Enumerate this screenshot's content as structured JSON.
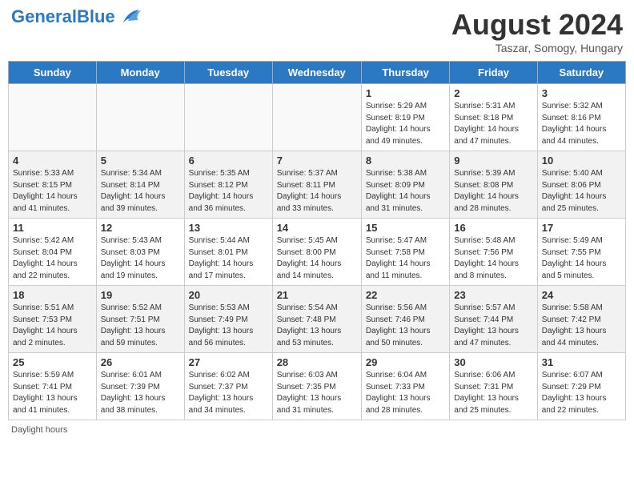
{
  "header": {
    "logo_general": "General",
    "logo_blue": "Blue",
    "month": "August 2024",
    "location": "Taszar, Somogy, Hungary"
  },
  "days_of_week": [
    "Sunday",
    "Monday",
    "Tuesday",
    "Wednesday",
    "Thursday",
    "Friday",
    "Saturday"
  ],
  "weeks": [
    [
      {
        "num": "",
        "info": ""
      },
      {
        "num": "",
        "info": ""
      },
      {
        "num": "",
        "info": ""
      },
      {
        "num": "",
        "info": ""
      },
      {
        "num": "1",
        "info": "Sunrise: 5:29 AM\nSunset: 8:19 PM\nDaylight: 14 hours\nand 49 minutes."
      },
      {
        "num": "2",
        "info": "Sunrise: 5:31 AM\nSunset: 8:18 PM\nDaylight: 14 hours\nand 47 minutes."
      },
      {
        "num": "3",
        "info": "Sunrise: 5:32 AM\nSunset: 8:16 PM\nDaylight: 14 hours\nand 44 minutes."
      }
    ],
    [
      {
        "num": "4",
        "info": "Sunrise: 5:33 AM\nSunset: 8:15 PM\nDaylight: 14 hours\nand 41 minutes."
      },
      {
        "num": "5",
        "info": "Sunrise: 5:34 AM\nSunset: 8:14 PM\nDaylight: 14 hours\nand 39 minutes."
      },
      {
        "num": "6",
        "info": "Sunrise: 5:35 AM\nSunset: 8:12 PM\nDaylight: 14 hours\nand 36 minutes."
      },
      {
        "num": "7",
        "info": "Sunrise: 5:37 AM\nSunset: 8:11 PM\nDaylight: 14 hours\nand 33 minutes."
      },
      {
        "num": "8",
        "info": "Sunrise: 5:38 AM\nSunset: 8:09 PM\nDaylight: 14 hours\nand 31 minutes."
      },
      {
        "num": "9",
        "info": "Sunrise: 5:39 AM\nSunset: 8:08 PM\nDaylight: 14 hours\nand 28 minutes."
      },
      {
        "num": "10",
        "info": "Sunrise: 5:40 AM\nSunset: 8:06 PM\nDaylight: 14 hours\nand 25 minutes."
      }
    ],
    [
      {
        "num": "11",
        "info": "Sunrise: 5:42 AM\nSunset: 8:04 PM\nDaylight: 14 hours\nand 22 minutes."
      },
      {
        "num": "12",
        "info": "Sunrise: 5:43 AM\nSunset: 8:03 PM\nDaylight: 14 hours\nand 19 minutes."
      },
      {
        "num": "13",
        "info": "Sunrise: 5:44 AM\nSunset: 8:01 PM\nDaylight: 14 hours\nand 17 minutes."
      },
      {
        "num": "14",
        "info": "Sunrise: 5:45 AM\nSunset: 8:00 PM\nDaylight: 14 hours\nand 14 minutes."
      },
      {
        "num": "15",
        "info": "Sunrise: 5:47 AM\nSunset: 7:58 PM\nDaylight: 14 hours\nand 11 minutes."
      },
      {
        "num": "16",
        "info": "Sunrise: 5:48 AM\nSunset: 7:56 PM\nDaylight: 14 hours\nand 8 minutes."
      },
      {
        "num": "17",
        "info": "Sunrise: 5:49 AM\nSunset: 7:55 PM\nDaylight: 14 hours\nand 5 minutes."
      }
    ],
    [
      {
        "num": "18",
        "info": "Sunrise: 5:51 AM\nSunset: 7:53 PM\nDaylight: 14 hours\nand 2 minutes."
      },
      {
        "num": "19",
        "info": "Sunrise: 5:52 AM\nSunset: 7:51 PM\nDaylight: 13 hours\nand 59 minutes."
      },
      {
        "num": "20",
        "info": "Sunrise: 5:53 AM\nSunset: 7:49 PM\nDaylight: 13 hours\nand 56 minutes."
      },
      {
        "num": "21",
        "info": "Sunrise: 5:54 AM\nSunset: 7:48 PM\nDaylight: 13 hours\nand 53 minutes."
      },
      {
        "num": "22",
        "info": "Sunrise: 5:56 AM\nSunset: 7:46 PM\nDaylight: 13 hours\nand 50 minutes."
      },
      {
        "num": "23",
        "info": "Sunrise: 5:57 AM\nSunset: 7:44 PM\nDaylight: 13 hours\nand 47 minutes."
      },
      {
        "num": "24",
        "info": "Sunrise: 5:58 AM\nSunset: 7:42 PM\nDaylight: 13 hours\nand 44 minutes."
      }
    ],
    [
      {
        "num": "25",
        "info": "Sunrise: 5:59 AM\nSunset: 7:41 PM\nDaylight: 13 hours\nand 41 minutes."
      },
      {
        "num": "26",
        "info": "Sunrise: 6:01 AM\nSunset: 7:39 PM\nDaylight: 13 hours\nand 38 minutes."
      },
      {
        "num": "27",
        "info": "Sunrise: 6:02 AM\nSunset: 7:37 PM\nDaylight: 13 hours\nand 34 minutes."
      },
      {
        "num": "28",
        "info": "Sunrise: 6:03 AM\nSunset: 7:35 PM\nDaylight: 13 hours\nand 31 minutes."
      },
      {
        "num": "29",
        "info": "Sunrise: 6:04 AM\nSunset: 7:33 PM\nDaylight: 13 hours\nand 28 minutes."
      },
      {
        "num": "30",
        "info": "Sunrise: 6:06 AM\nSunset: 7:31 PM\nDaylight: 13 hours\nand 25 minutes."
      },
      {
        "num": "31",
        "info": "Sunrise: 6:07 AM\nSunset: 7:29 PM\nDaylight: 13 hours\nand 22 minutes."
      }
    ]
  ],
  "footer": {
    "daylight_label": "Daylight hours"
  }
}
